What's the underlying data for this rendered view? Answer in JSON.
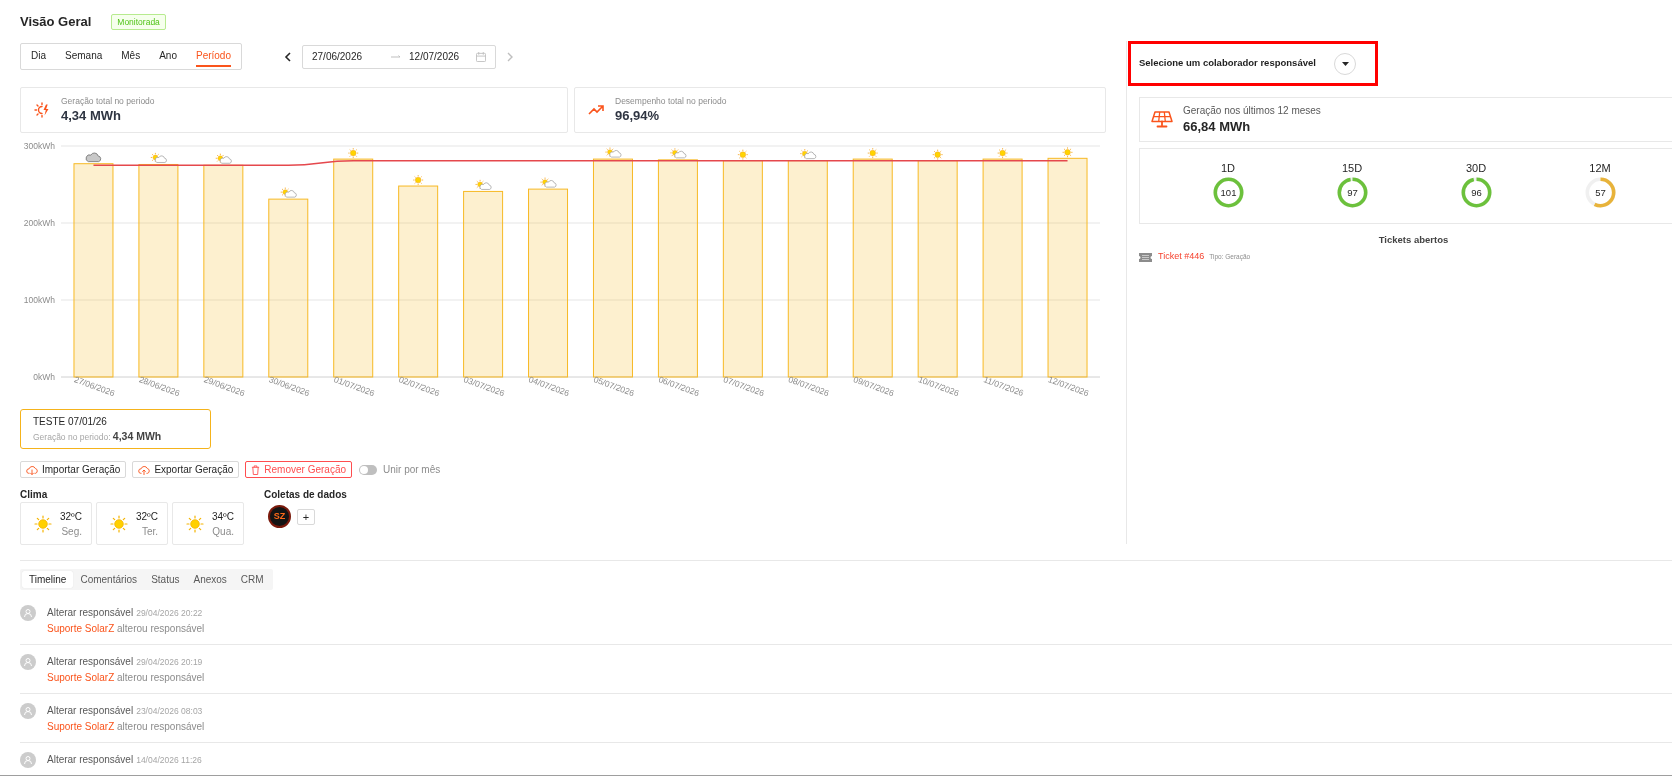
{
  "header": {
    "title": "Visão Geral",
    "badge": "Monitorada"
  },
  "period_tabs": [
    {
      "label": "Dia",
      "selected": false
    },
    {
      "label": "Semana",
      "selected": false
    },
    {
      "label": "Mês",
      "selected": false
    },
    {
      "label": "Ano",
      "selected": false
    },
    {
      "label": "Período",
      "selected": true
    }
  ],
  "date_range": {
    "start": "27/06/2026",
    "end": "12/07/2026"
  },
  "stats": [
    {
      "kind": "generation",
      "label": "Geração total no periodo",
      "value": "4,34 MWh"
    },
    {
      "kind": "performance",
      "label": "Desempenho total no periodo",
      "value": "96,94%"
    }
  ],
  "chart": {
    "chart_data": {
      "type": "bar",
      "categories": [
        "27/06/2026",
        "28/06/2026",
        "29/06/2026",
        "30/06/2026",
        "01/07/2026",
        "02/07/2026",
        "03/07/2026",
        "04/07/2026",
        "05/07/2026",
        "06/07/2026",
        "07/07/2026",
        "08/07/2026",
        "09/07/2026",
        "10/07/2026",
        "11/07/2026",
        "12/07/2026"
      ],
      "series": [
        {
          "type": "bar",
          "color": "#f7b924",
          "values": [
            277,
            276,
            275,
            231,
            283,
            248,
            241,
            244,
            283,
            282,
            281,
            281,
            283,
            281,
            283,
            284
          ]
        },
        {
          "type": "line",
          "color": "#e5484d",
          "values": [
            275,
            275,
            275,
            275,
            281,
            281,
            281,
            281,
            281,
            281,
            281,
            281,
            281,
            281,
            281,
            281
          ]
        }
      ],
      "ylim": [
        0,
        300
      ],
      "yticks": [
        {
          "value": 0,
          "label": "0kWh"
        },
        {
          "value": 100,
          "label": "100kWh"
        },
        {
          "value": 200,
          "label": "200kWh"
        },
        {
          "value": 300,
          "label": "300kWh"
        }
      ]
    },
    "weather_markers": [
      {
        "kind": "cloudy"
      },
      {
        "kind": "partly_cloudy"
      },
      {
        "kind": "partly_cloudy"
      },
      {
        "kind": "partly_cloudy"
      },
      {
        "kind": "sunny"
      },
      {
        "kind": "sunny"
      },
      {
        "kind": "partly_cloudy"
      },
      {
        "kind": "partly_cloudy"
      },
      {
        "kind": "partly_cloudy"
      },
      {
        "kind": "partly_cloudy"
      },
      {
        "kind": "sunny"
      },
      {
        "kind": "partly_cloudy"
      },
      {
        "kind": "sunny"
      },
      {
        "kind": "sunny"
      },
      {
        "kind": "sunny"
      },
      {
        "kind": "sunny"
      }
    ]
  },
  "plant_card": {
    "name": "TESTE 07/01/26",
    "summary": "Geração no periodo: **4,34 MWh**"
  },
  "actions": [
    {
      "kind": "import",
      "label": "Importar Geração"
    },
    {
      "kind": "export",
      "label": "Exportar Geração"
    },
    {
      "kind": "remove",
      "label": "Remover Geração"
    }
  ],
  "merge_toggle": {
    "label": "Unir por mês",
    "on": false
  },
  "climate": {
    "title": "Clima",
    "days": [
      {
        "temperature": "32ºC",
        "day": "Seg."
      },
      {
        "temperature": "32ºC",
        "day": "Ter."
      },
      {
        "temperature": "34ºC",
        "day": "Qua."
      }
    ]
  },
  "data_collection": {
    "title": "Coletas de dados",
    "logo": "SZ",
    "add_label": "+"
  },
  "responsible": {
    "label": "Selecione um colaborador responsável"
  },
  "generation_12m": {
    "label": "Geração nos últimos 12 meses",
    "value": "66,84 MWh"
  },
  "scores": [
    {
      "label": "1D",
      "value": "101",
      "level": 1,
      "color": "#6cc13c"
    },
    {
      "label": "15D",
      "value": "97",
      "level": 0.97,
      "color": "#6cc13c"
    },
    {
      "label": "30D",
      "value": "96",
      "level": 0.96,
      "color": "#6cc13c"
    },
    {
      "label": "12M",
      "value": "57",
      "level": 0.57,
      "color": "#e8b33a"
    }
  ],
  "tickets": {
    "title": "Tickets abertos",
    "items": [
      {
        "label": "Ticket #446",
        "type": "Tipo: Geração"
      }
    ]
  },
  "timeline_tabs": [
    {
      "label": "Timeline",
      "selected": true
    },
    {
      "label": "Comentários",
      "selected": false
    },
    {
      "label": "Status",
      "selected": false
    },
    {
      "label": "Anexos",
      "selected": false
    },
    {
      "label": "CRM",
      "selected": false
    }
  ],
  "timeline": [
    {
      "title": "Alterar responsável",
      "time": "29/04/2026 20:22",
      "actor": "Suporte SolarZ",
      "action": "alterou responsável"
    },
    {
      "title": "Alterar responsável",
      "time": "29/04/2026 20:19",
      "actor": "Suporte SolarZ",
      "action": "alterou responsável"
    },
    {
      "title": "Alterar responsável",
      "time": "23/04/2026 08:03",
      "actor": "Suporte SolarZ",
      "action": "alterou responsável"
    },
    {
      "title": "Alterar responsável",
      "time": "14/04/2026 11:26"
    }
  ]
}
